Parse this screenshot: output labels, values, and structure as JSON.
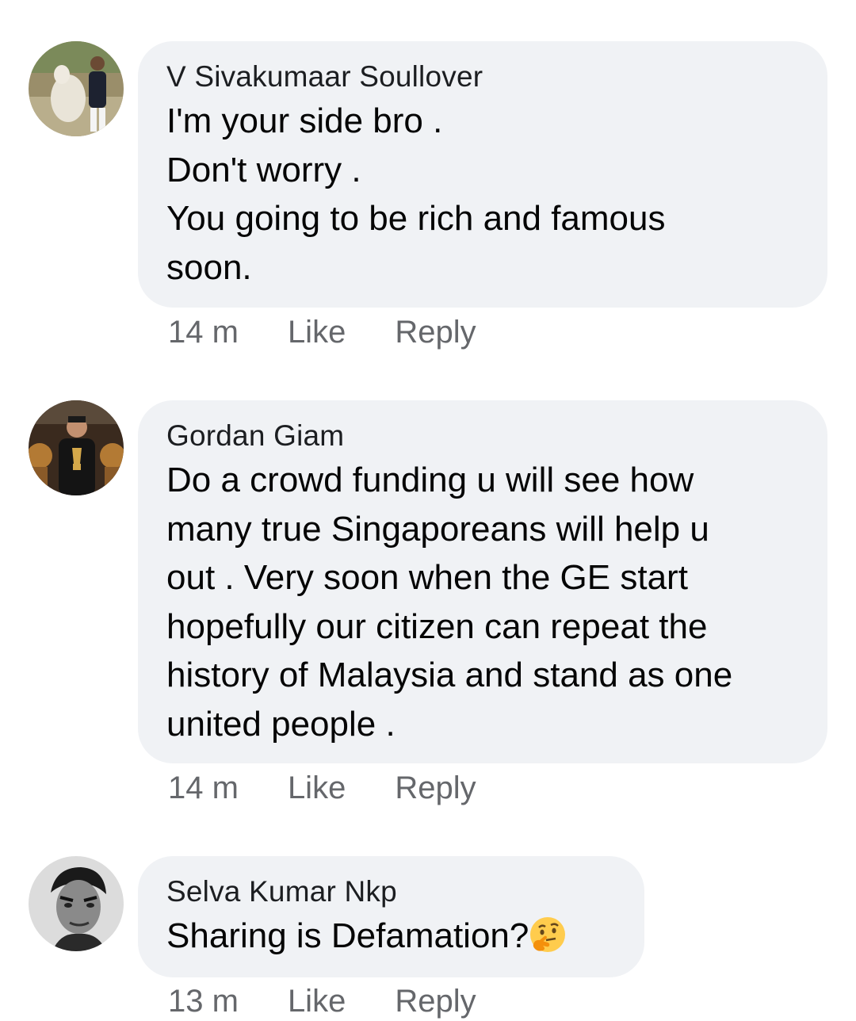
{
  "comments": [
    {
      "author": "V Sivakumaar Soullover",
      "lines": [
        "I'm your side bro .",
        "Don't worry .",
        "You going to be rich and famous",
        "soon."
      ],
      "time": "14 m",
      "like_label": "Like",
      "reply_label": "Reply",
      "avatar_icon": "avatar-man-with-cow"
    },
    {
      "author": "Gordan Giam",
      "lines": [
        "Do a crowd funding u will see how",
        "many true Singaporeans will help u",
        "out . Very soon when the GE start",
        "hopefully our citizen can repeat the",
        "history of Malaysia and stand as one",
        "united people ."
      ],
      "time": "14 m",
      "like_label": "Like",
      "reply_label": "Reply",
      "avatar_icon": "avatar-man-with-trophy"
    },
    {
      "author": "Selva Kumar Nkp",
      "lines": [
        "Sharing is Defamation?"
      ],
      "emoji": "thinking-face-emoji",
      "time": "13 m",
      "like_label": "Like",
      "reply_label": "Reply",
      "avatar_icon": "avatar-vintage-portrait"
    }
  ],
  "colors": {
    "bubble": "#f0f2f5",
    "author": "#1c1e21",
    "text": "#050505",
    "meta": "#65676b"
  }
}
